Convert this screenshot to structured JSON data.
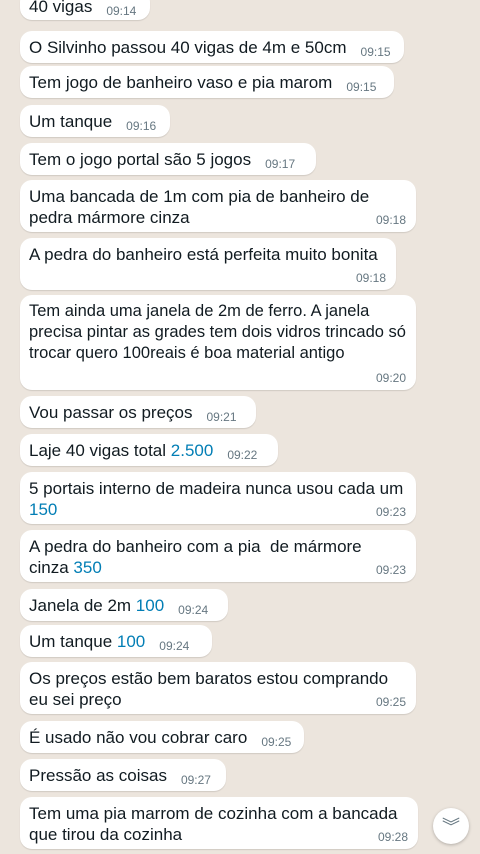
{
  "messages": [
    {
      "text": "40 vigas",
      "time": "09:14"
    },
    {
      "text": "O Silvinho passou 40 vigas de 4m e 50cm",
      "time": "09:15"
    },
    {
      "text": "Tem jogo de banheiro vaso e pia marom",
      "time": "09:15"
    },
    {
      "text": "Um tanque",
      "time": "09:16"
    },
    {
      "text": "Tem o jogo portal são 5 jogos",
      "time": "09:17"
    },
    {
      "text": "Uma bancada de 1m com pia de banheiro de pedra mármore cinza",
      "time": "09:18"
    },
    {
      "text": "A pedra do banheiro está perfeita muito bonita",
      "time": "09:18"
    },
    {
      "text": "Tem ainda uma janela de 2m de ferro. A janela precisa pintar as grades tem dois vidros trincado só trocar quero 100reais é boa material antigo",
      "time": "09:20"
    },
    {
      "text": "Vou passar os preços",
      "time": "09:21"
    },
    {
      "text": "Laje 40 vigas total ",
      "num": "2.500",
      "time": "09:22"
    },
    {
      "text": "5 portais interno de madeira nunca usou cada um ",
      "num": "150",
      "time": "09:23"
    },
    {
      "text": "A pedra do banheiro com a pia  de mármore cinza ",
      "num": "350",
      "time": "09:23"
    },
    {
      "text": "Janela de 2m ",
      "num": "100",
      "time": "09:24"
    },
    {
      "text": "Um tanque ",
      "num": "100",
      "time": "09:24"
    },
    {
      "text": "Os preços estão bem baratos estou comprando eu sei preço",
      "time": "09:25"
    },
    {
      "text": "É usado não vou cobrar caro",
      "time": "09:25"
    },
    {
      "text": "Pressão as coisas",
      "time": "09:27"
    },
    {
      "text": "Tem uma pia marrom de cozinha com a bancada que tirou da cozinha",
      "time": "09:28"
    }
  ],
  "scroll_button": {
    "icon": "double-chevron-down-icon",
    "glyph": "︾"
  },
  "colors": {
    "background": "#ece5dd",
    "bubble": "#ffffff",
    "link_number": "#027eb5",
    "timestamp": "#667781"
  }
}
